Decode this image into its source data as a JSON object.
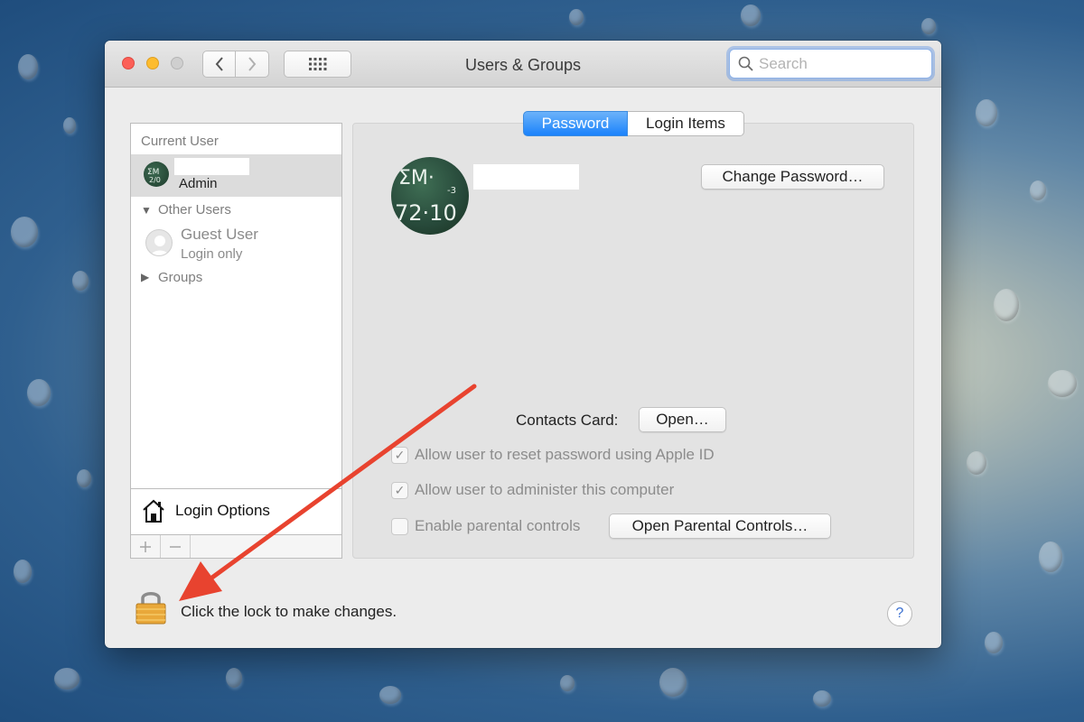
{
  "window": {
    "title": "Users & Groups"
  },
  "toolbar": {
    "back_icon": "chevron-left-icon",
    "forward_icon": "chevron-right-icon",
    "grid_icon": "grid-icon",
    "search_placeholder": "Search"
  },
  "sidebar": {
    "current_user_header": "Current User",
    "current_user": {
      "name": "",
      "role": "Admin"
    },
    "other_users_header": "Other Users",
    "guest": {
      "name": "Guest User",
      "subtitle": "Login only"
    },
    "groups_header": "Groups",
    "login_options_label": "Login Options",
    "add_icon": "plus-icon",
    "remove_icon": "minus-icon"
  },
  "main": {
    "tabs": [
      {
        "label": "Password",
        "selected": true
      },
      {
        "label": "Login Items",
        "selected": false
      }
    ],
    "user_name": "",
    "change_password_label": "Change Password…",
    "contacts_card_label": "Contacts Card:",
    "open_label": "Open…",
    "checkboxes": [
      {
        "label": "Allow user to reset password using Apple ID",
        "checked": true,
        "enabled": false
      },
      {
        "label": "Allow user to administer this computer",
        "checked": true,
        "enabled": false
      },
      {
        "label": "Enable parental controls",
        "checked": false,
        "enabled": false
      }
    ],
    "open_parental_controls_label": "Open Parental Controls…"
  },
  "footer": {
    "lock_text": "Click the lock to make changes.",
    "help_label": "?"
  },
  "colors": {
    "accent": "#1a82fb",
    "annotation_arrow": "#e8432f",
    "close": "#fc5f57",
    "minimize": "#fdbc2e"
  }
}
